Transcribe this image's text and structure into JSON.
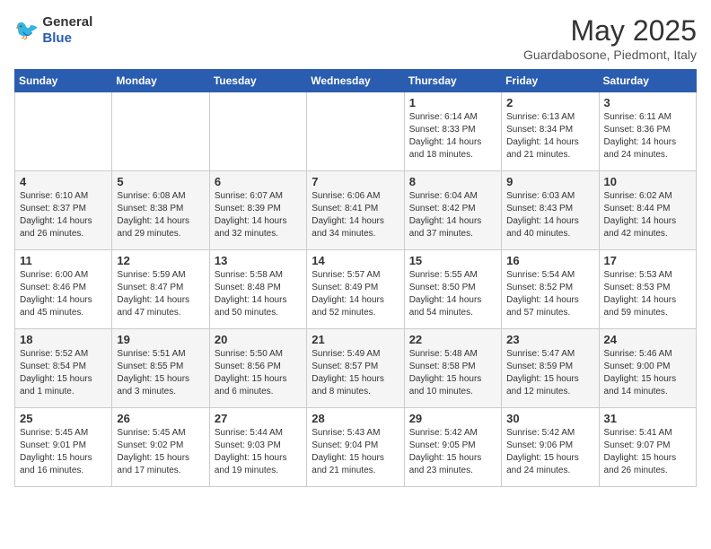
{
  "logo": {
    "general": "General",
    "blue": "Blue"
  },
  "title": "May 2025",
  "subtitle": "Guardabosone, Piedmont, Italy",
  "header": {
    "days": [
      "Sunday",
      "Monday",
      "Tuesday",
      "Wednesday",
      "Thursday",
      "Friday",
      "Saturday"
    ]
  },
  "weeks": [
    [
      {
        "day": "",
        "detail": ""
      },
      {
        "day": "",
        "detail": ""
      },
      {
        "day": "",
        "detail": ""
      },
      {
        "day": "",
        "detail": ""
      },
      {
        "day": "1",
        "detail": "Sunrise: 6:14 AM\nSunset: 8:33 PM\nDaylight: 14 hours\nand 18 minutes."
      },
      {
        "day": "2",
        "detail": "Sunrise: 6:13 AM\nSunset: 8:34 PM\nDaylight: 14 hours\nand 21 minutes."
      },
      {
        "day": "3",
        "detail": "Sunrise: 6:11 AM\nSunset: 8:36 PM\nDaylight: 14 hours\nand 24 minutes."
      }
    ],
    [
      {
        "day": "4",
        "detail": "Sunrise: 6:10 AM\nSunset: 8:37 PM\nDaylight: 14 hours\nand 26 minutes."
      },
      {
        "day": "5",
        "detail": "Sunrise: 6:08 AM\nSunset: 8:38 PM\nDaylight: 14 hours\nand 29 minutes."
      },
      {
        "day": "6",
        "detail": "Sunrise: 6:07 AM\nSunset: 8:39 PM\nDaylight: 14 hours\nand 32 minutes."
      },
      {
        "day": "7",
        "detail": "Sunrise: 6:06 AM\nSunset: 8:41 PM\nDaylight: 14 hours\nand 34 minutes."
      },
      {
        "day": "8",
        "detail": "Sunrise: 6:04 AM\nSunset: 8:42 PM\nDaylight: 14 hours\nand 37 minutes."
      },
      {
        "day": "9",
        "detail": "Sunrise: 6:03 AM\nSunset: 8:43 PM\nDaylight: 14 hours\nand 40 minutes."
      },
      {
        "day": "10",
        "detail": "Sunrise: 6:02 AM\nSunset: 8:44 PM\nDaylight: 14 hours\nand 42 minutes."
      }
    ],
    [
      {
        "day": "11",
        "detail": "Sunrise: 6:00 AM\nSunset: 8:46 PM\nDaylight: 14 hours\nand 45 minutes."
      },
      {
        "day": "12",
        "detail": "Sunrise: 5:59 AM\nSunset: 8:47 PM\nDaylight: 14 hours\nand 47 minutes."
      },
      {
        "day": "13",
        "detail": "Sunrise: 5:58 AM\nSunset: 8:48 PM\nDaylight: 14 hours\nand 50 minutes."
      },
      {
        "day": "14",
        "detail": "Sunrise: 5:57 AM\nSunset: 8:49 PM\nDaylight: 14 hours\nand 52 minutes."
      },
      {
        "day": "15",
        "detail": "Sunrise: 5:55 AM\nSunset: 8:50 PM\nDaylight: 14 hours\nand 54 minutes."
      },
      {
        "day": "16",
        "detail": "Sunrise: 5:54 AM\nSunset: 8:52 PM\nDaylight: 14 hours\nand 57 minutes."
      },
      {
        "day": "17",
        "detail": "Sunrise: 5:53 AM\nSunset: 8:53 PM\nDaylight: 14 hours\nand 59 minutes."
      }
    ],
    [
      {
        "day": "18",
        "detail": "Sunrise: 5:52 AM\nSunset: 8:54 PM\nDaylight: 15 hours\nand 1 minute."
      },
      {
        "day": "19",
        "detail": "Sunrise: 5:51 AM\nSunset: 8:55 PM\nDaylight: 15 hours\nand 3 minutes."
      },
      {
        "day": "20",
        "detail": "Sunrise: 5:50 AM\nSunset: 8:56 PM\nDaylight: 15 hours\nand 6 minutes."
      },
      {
        "day": "21",
        "detail": "Sunrise: 5:49 AM\nSunset: 8:57 PM\nDaylight: 15 hours\nand 8 minutes."
      },
      {
        "day": "22",
        "detail": "Sunrise: 5:48 AM\nSunset: 8:58 PM\nDaylight: 15 hours\nand 10 minutes."
      },
      {
        "day": "23",
        "detail": "Sunrise: 5:47 AM\nSunset: 8:59 PM\nDaylight: 15 hours\nand 12 minutes."
      },
      {
        "day": "24",
        "detail": "Sunrise: 5:46 AM\nSunset: 9:00 PM\nDaylight: 15 hours\nand 14 minutes."
      }
    ],
    [
      {
        "day": "25",
        "detail": "Sunrise: 5:45 AM\nSunset: 9:01 PM\nDaylight: 15 hours\nand 16 minutes."
      },
      {
        "day": "26",
        "detail": "Sunrise: 5:45 AM\nSunset: 9:02 PM\nDaylight: 15 hours\nand 17 minutes."
      },
      {
        "day": "27",
        "detail": "Sunrise: 5:44 AM\nSunset: 9:03 PM\nDaylight: 15 hours\nand 19 minutes."
      },
      {
        "day": "28",
        "detail": "Sunrise: 5:43 AM\nSunset: 9:04 PM\nDaylight: 15 hours\nand 21 minutes."
      },
      {
        "day": "29",
        "detail": "Sunrise: 5:42 AM\nSunset: 9:05 PM\nDaylight: 15 hours\nand 23 minutes."
      },
      {
        "day": "30",
        "detail": "Sunrise: 5:42 AM\nSunset: 9:06 PM\nDaylight: 15 hours\nand 24 minutes."
      },
      {
        "day": "31",
        "detail": "Sunrise: 5:41 AM\nSunset: 9:07 PM\nDaylight: 15 hours\nand 26 minutes."
      }
    ]
  ]
}
